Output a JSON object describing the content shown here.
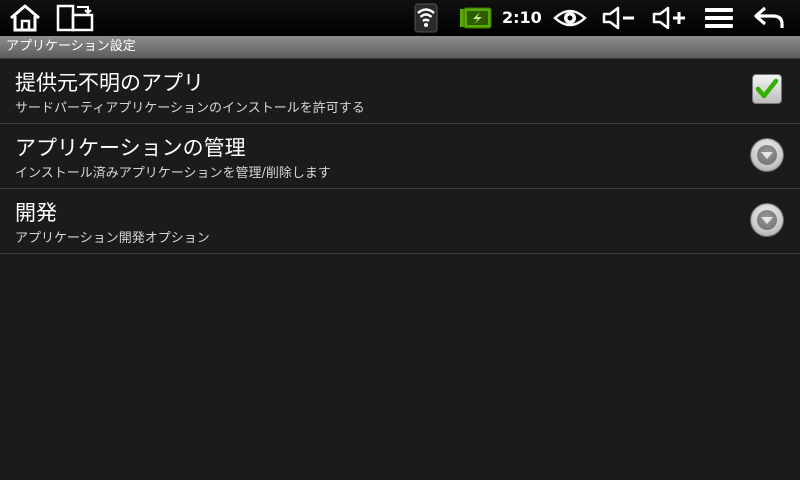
{
  "status_bar": {
    "icons": [
      "home-icon",
      "screen-rotate-icon",
      "wifi-icon",
      "battery-charging-icon",
      "eye-icon",
      "volume-down-icon",
      "volume-up-icon",
      "menu-icon",
      "back-icon"
    ],
    "clock": "2:10",
    "battery_color": "#5aa800"
  },
  "title_bar": {
    "title": "アプリケーション設定"
  },
  "settings": {
    "items": [
      {
        "title": "提供元不明のアプリ",
        "summary": "サードパーティアプリケーションのインストールを許可する",
        "widget": "checkbox",
        "checked": true
      },
      {
        "title": "アプリケーションの管理",
        "summary": "インストール済みアプリケーションを管理/削除します",
        "widget": "chevron"
      },
      {
        "title": "開発",
        "summary": "アプリケーション開発オプション",
        "widget": "chevron"
      }
    ]
  },
  "colors": {
    "background": "#1b1b1b",
    "check_green": "#33b000",
    "divider": "#3d3d3d"
  }
}
